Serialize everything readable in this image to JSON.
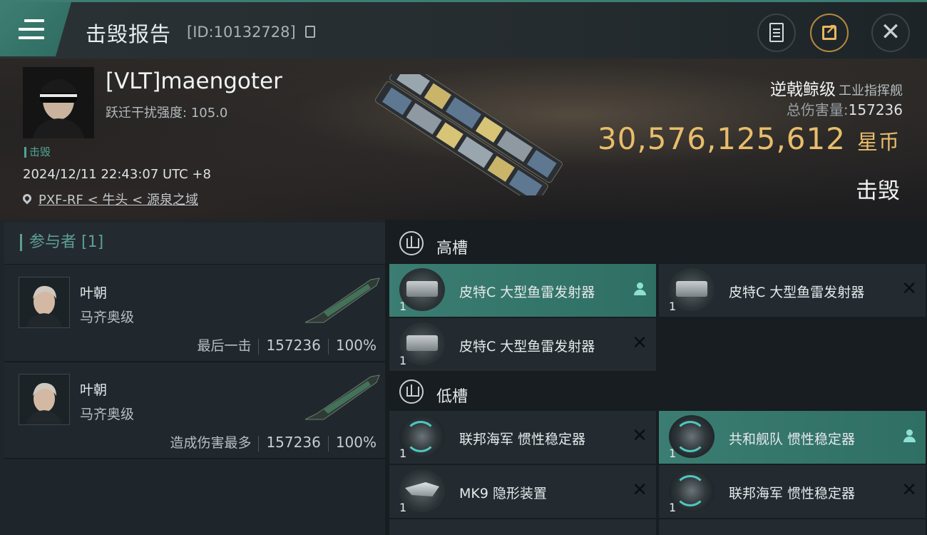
{
  "header": {
    "title": "击毁报告",
    "report_id": "[ID:10132728]"
  },
  "victim": {
    "name": "[VLT]maengoter",
    "warp_label": "跃迁干扰强度:",
    "warp_value": "105.0",
    "tag": "击毁",
    "datetime": "2024/12/11 22:43:07 UTC +8",
    "location": "PXF-RF < 牛头 < 源泉之域",
    "ship": "逆戟鲸级",
    "ship_type": "工业指挥舰",
    "total_damage_label": "总伤害量:",
    "total_damage": "157236",
    "isk_value": "30,576,125,612",
    "isk_unit": "星币",
    "status": "击毁"
  },
  "participants": {
    "label": "参与者 [1]",
    "rows": [
      {
        "name": "叶朝",
        "ship": "马齐奥级",
        "label": "最后一击",
        "damage": "157236",
        "percent": "100%"
      },
      {
        "name": "叶朝",
        "ship": "马齐奥级",
        "label": "造成伤害最多",
        "damage": "157236",
        "percent": "100%"
      }
    ]
  },
  "fitting": {
    "high_label": "高槽",
    "low_label": "低槽",
    "high": [
      {
        "name": "皮特C 大型鱼雷发射器",
        "qty": "1"
      },
      {
        "name": "皮特C 大型鱼雷发射器",
        "qty": "1"
      },
      {
        "name": "皮特C 大型鱼雷发射器",
        "qty": "1"
      }
    ],
    "low": [
      {
        "name": "联邦海军 惯性稳定器",
        "qty": "1"
      },
      {
        "name": "共和舰队 惯性稳定器",
        "qty": "1"
      },
      {
        "name": "MK9 隐形装置",
        "qty": "1"
      },
      {
        "name": "联邦海军 惯性稳定器",
        "qty": "1"
      }
    ]
  },
  "colors": {
    "accent": "#3d7f74",
    "isk": "#e8bd6a"
  }
}
